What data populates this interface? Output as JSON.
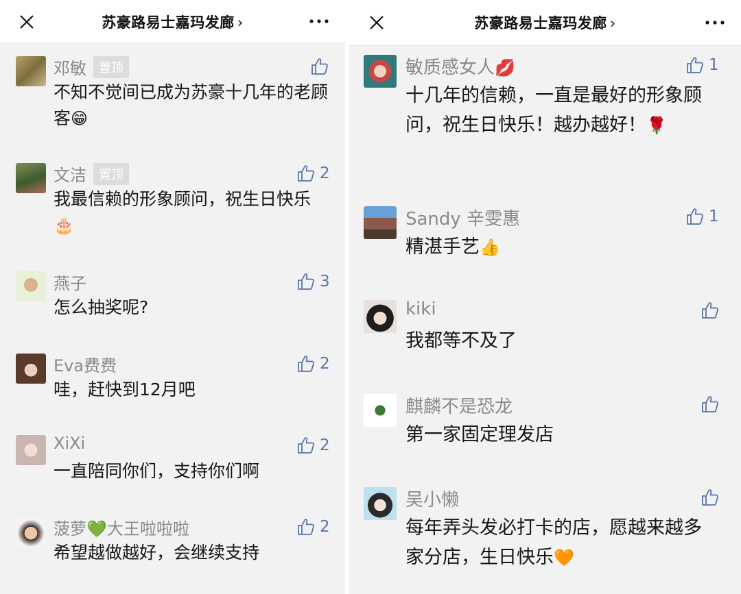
{
  "colors": {
    "background": "#f2f2f2",
    "topbar": "#ffffff",
    "like_blue": "#5a73a8",
    "name_gray": "#8a8a8a"
  },
  "left": {
    "title": "苏豪路易士嘉玛发廊",
    "title_chevron": "›",
    "comments": [
      {
        "name": "邓敏",
        "pinned": "置顶",
        "text": "不知不觉间已成为苏豪十几年的老顾客",
        "emoji": "😁",
        "likes": ""
      },
      {
        "name": "文洁",
        "pinned": "置顶",
        "text": "我最信赖的形象顾问，祝生日快乐",
        "emoji": "🎂",
        "likes": "2"
      },
      {
        "name": "燕子",
        "text": "怎么抽奖呢?",
        "emoji": "",
        "likes": "3"
      },
      {
        "name": "Eva费费",
        "text": "哇，赶快到12月吧",
        "emoji": "",
        "likes": "2"
      },
      {
        "name": "XiXi",
        "text": "一直陪同你们，支持你们啊",
        "emoji": "",
        "likes": "2"
      },
      {
        "name": "菠萝",
        "name_emoji": "💚",
        "name_suffix": "大王啦啦啦",
        "text": "希望越做越好，会继续支持",
        "emoji": "",
        "likes": "2"
      }
    ]
  },
  "right": {
    "title": "苏豪路易士嘉玛发廊",
    "title_chevron": "›",
    "comments": [
      {
        "name": "敏质感女人",
        "name_emoji": "💋",
        "text": "十几年的信赖，一直是最好的形象顾问，祝生日快乐！越办越好！",
        "emoji": "🌹",
        "likes": "1"
      },
      {
        "name": "Sandy 辛雯惠",
        "text": "精湛手艺",
        "emoji": "👍",
        "likes": "1"
      },
      {
        "name": "kiki",
        "text": "我都等不及了",
        "emoji": "",
        "likes": ""
      },
      {
        "name": "麒麟不是恐龙",
        "text": "第一家固定理发店",
        "emoji": "",
        "likes": ""
      },
      {
        "name": "吴小懒",
        "text": "每年弄头发必打卡的店，愿越来越多家分店，生日快乐",
        "emoji": "🧡",
        "likes": ""
      }
    ]
  }
}
